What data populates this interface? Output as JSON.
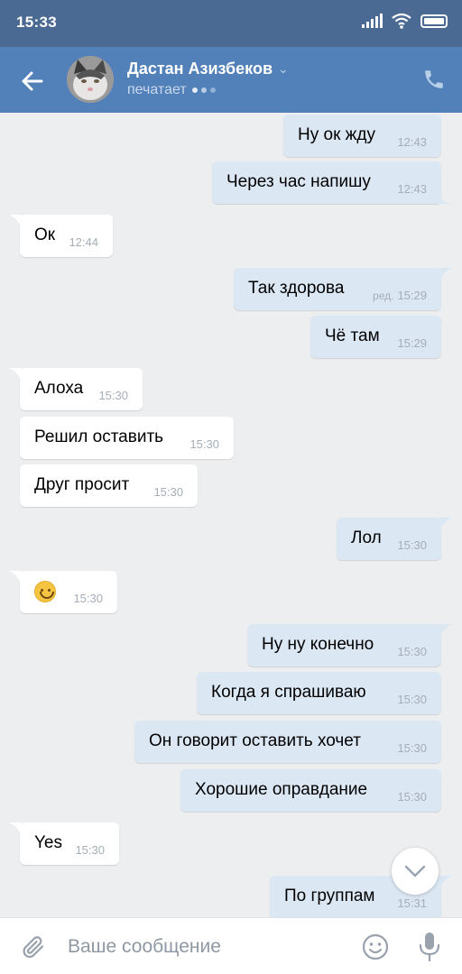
{
  "status_bar": {
    "time": "15:33"
  },
  "header": {
    "contact_name": "Дастан Азизбеков",
    "status": "печатает"
  },
  "messages": [
    {
      "dir": "out",
      "text": "Ну ок жду",
      "time": "12:43"
    },
    {
      "dir": "out",
      "text": "Через час напишу",
      "time": "12:43"
    },
    {
      "dir": "in",
      "text": "Ок",
      "time": "12:44"
    },
    {
      "dir": "out",
      "text": "Так здорова",
      "time": "15:29",
      "edited": "ред."
    },
    {
      "dir": "out",
      "text": "Чё там",
      "time": "15:29"
    },
    {
      "dir": "in",
      "text": "Алоха",
      "time": "15:30"
    },
    {
      "dir": "in",
      "text": "Решил оставить",
      "time": "15:30"
    },
    {
      "dir": "in",
      "text": "Друг просит",
      "time": "15:30"
    },
    {
      "dir": "out",
      "text": "Лол",
      "time": "15:30"
    },
    {
      "dir": "in",
      "emoji": "smiling-face",
      "time": "15:30"
    },
    {
      "dir": "out",
      "text": "Ну ну конечно",
      "time": "15:30"
    },
    {
      "dir": "out",
      "text": "Когда я спрашиваю",
      "time": "15:30"
    },
    {
      "dir": "out",
      "text": "Он говорит оставить хочет",
      "time": "15:30"
    },
    {
      "dir": "out",
      "text": "Хорошие оправдание",
      "time": "15:30"
    },
    {
      "dir": "in",
      "text": "Yes",
      "time": "15:30"
    },
    {
      "dir": "out",
      "text": "По группам",
      "time": "15:31"
    }
  ],
  "composer": {
    "placeholder": "Ваше сообщение"
  },
  "colors": {
    "header": "#5181b8",
    "status_bar": "#4a6a93",
    "outgoing_bubble": "#dce7f4",
    "incoming_bubble": "#ffffff",
    "background": "#edeef0"
  },
  "icons": {
    "back": "arrow-left-icon",
    "dropdown": "chevron-down-icon",
    "call": "phone-icon",
    "scroll_down": "chevron-down-icon",
    "attach": "paperclip-icon",
    "emoji": "smiley-icon",
    "voice": "microphone-icon"
  }
}
